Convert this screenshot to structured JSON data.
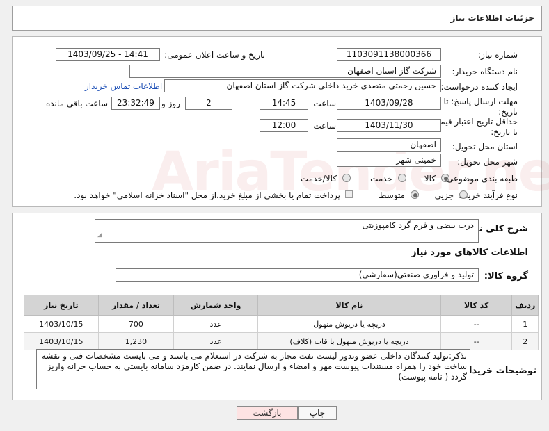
{
  "title": "جزئیات اطلاعات نیاز",
  "fields": {
    "need_number_label": "شماره نیاز:",
    "need_number": "1103091138000366",
    "announce_label": "تاریخ و ساعت اعلان عمومی:",
    "announce_value": "1403/09/25 - 14:41",
    "buyer_org_label": "نام دستگاه خریدار:",
    "buyer_org": "شرکت گاز استان اصفهان",
    "creator_label": "ایجاد کننده درخواست:",
    "creator": "حسین  رحمتی متصدی خرید داخلی شرکت گاز استان اصفهان",
    "contact_link": "اطلاعات تماس خریدار",
    "reply_deadline_label": "مهلت ارسال پاسخ: تا تاریخ:",
    "reply_date": "1403/09/28",
    "time_label": "ساعت",
    "reply_time": "14:45",
    "days_value": "2",
    "days_label": "روز و",
    "remaining_time": "23:32:49",
    "remaining_label": "ساعت باقی مانده",
    "validity_label": "حداقل تاریخ اعتبار قیمت: تا تاریخ:",
    "validity_date": "1403/11/30",
    "validity_time": "12:00",
    "province_label": "استان محل تحویل:",
    "province": "اصفهان",
    "city_label": "شهر محل تحویل:",
    "city": "خمینی شهر",
    "category_label": "طبقه بندی موضوعی:",
    "category_options": [
      "کالا",
      "خدمت",
      "کالا/خدمت"
    ],
    "process_label": "نوع فرآیند خرید :",
    "process_options": [
      "جزیی",
      "متوسط"
    ],
    "payment_note": "پرداخت تمام یا بخشی از مبلغ خرید،از محل \"اسناد خزانه اسلامی\" خواهد بود."
  },
  "description": {
    "label": "شرح کلی نیاز:",
    "value": "درب بیضی و فرم گرد کامپوزیتی"
  },
  "goods_info_title": "اطلاعات کالاهای مورد نیاز",
  "goods_group": {
    "label": "گروه کالا:",
    "value": "تولید و فرآوری صنعتی(سفارشی)"
  },
  "table": {
    "headers": [
      "ردیف",
      "کد کالا",
      "نام کالا",
      "واحد شمارش",
      "تعداد / مقدار",
      "تاریخ نیاز"
    ],
    "rows": [
      [
        "1",
        "--",
        "دریچه یا دریوش منهول",
        "عدد",
        "700",
        "1403/10/15"
      ],
      [
        "2",
        "--",
        "دریچه یا دریوش منهول با قاب (کلاف)",
        "عدد",
        "1,230",
        "1403/10/15"
      ]
    ]
  },
  "buyer_notes": {
    "label": "توضیحات خریدار:",
    "value": "تذکر:تولید کنندگان داخلی عضو وندور لیست نفت مجاز به شرکت در استعلام می باشند و می بایست مشخصات فنی و نقشه ساخت خود را همراه مستندات پیوست مهر و امضاء و ارسال نمایند. در ضمن کارمزد سامانه بایستی به حساب خزانه واریز گردد ( نامه پیوست)"
  },
  "buttons": {
    "print": "چاپ",
    "back": "بازگشت"
  },
  "watermark": "AriaTender.neT"
}
